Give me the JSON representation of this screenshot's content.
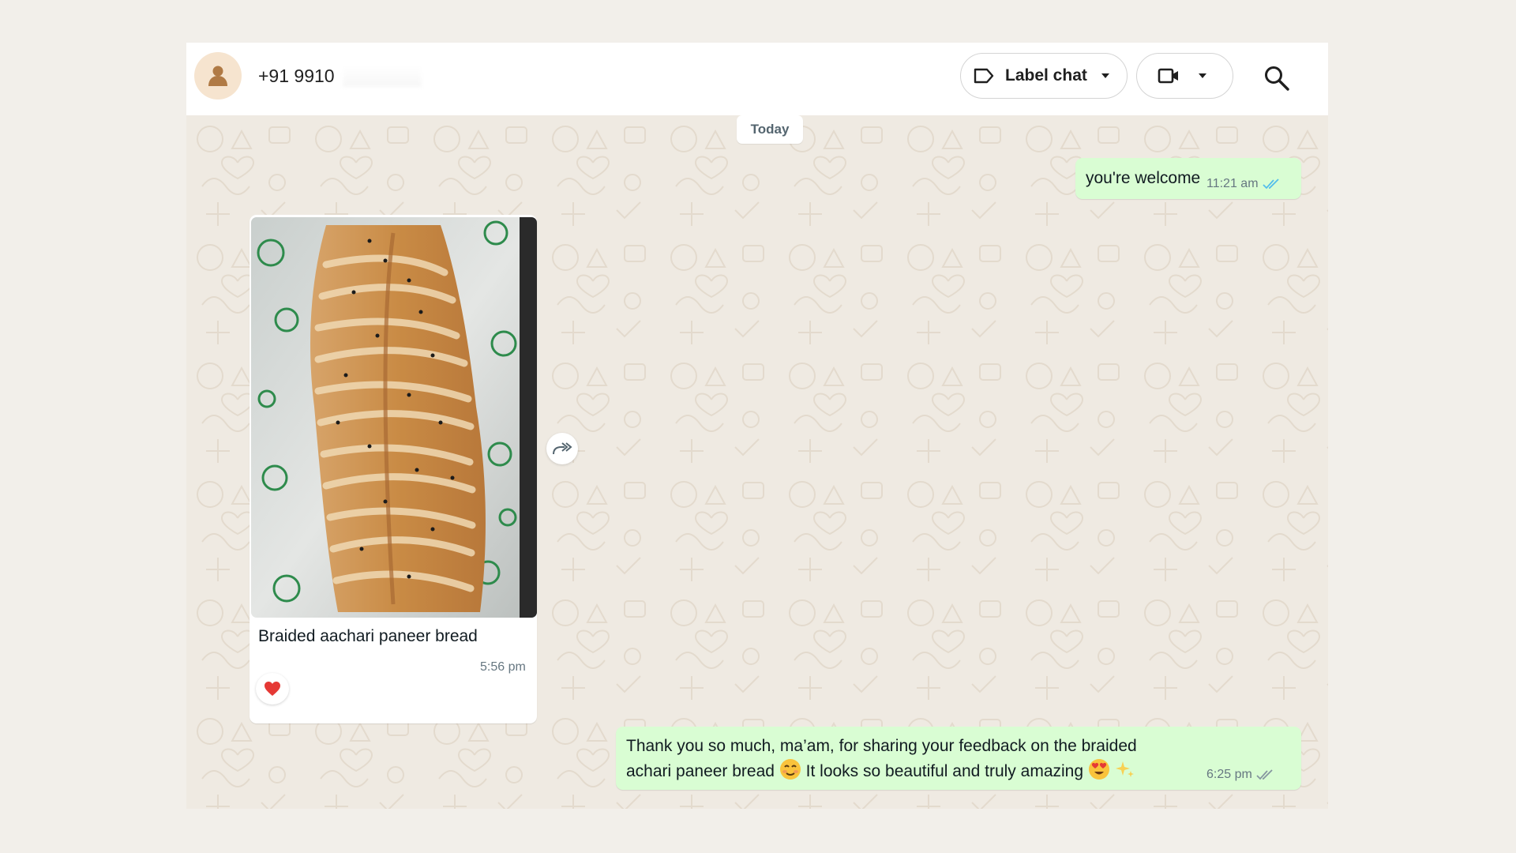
{
  "header": {
    "contact_name": "+91 9910",
    "label_chat": "Label chat",
    "icons": [
      "user-avatar-icon",
      "label-tag-icon",
      "chevron-down-icon",
      "video-camera-icon",
      "chevron-down-icon",
      "search-icon"
    ]
  },
  "date_separator": "Today",
  "messages": [
    {
      "direction": "outgoing",
      "text": "you're welcome",
      "time": "11:21 am",
      "status": "read",
      "tick_color": "#53bdeb"
    },
    {
      "direction": "incoming",
      "type": "image",
      "caption": "Braided aachari paneer bread",
      "time": "5:56 pm",
      "reaction": "heart",
      "reaction_color": "#e53935"
    },
    {
      "direction": "outgoing",
      "text_part1": "Thank you so much, ma’am, for sharing your feedback on the braided achari paneer bread",
      "text_part2": "It looks so beautiful and truly amazing",
      "emojis": [
        "smiling-face-icon",
        "heart-eyes-icon",
        "sparkles-icon"
      ],
      "time": "6:25 pm",
      "status": "delivered",
      "tick_color": "#8696a0"
    }
  ],
  "colors": {
    "page_background": "#f2efea",
    "chat_background": "#efeae2",
    "outgoing_bubble": "#d9fdd3",
    "incoming_bubble": "#ffffff"
  }
}
